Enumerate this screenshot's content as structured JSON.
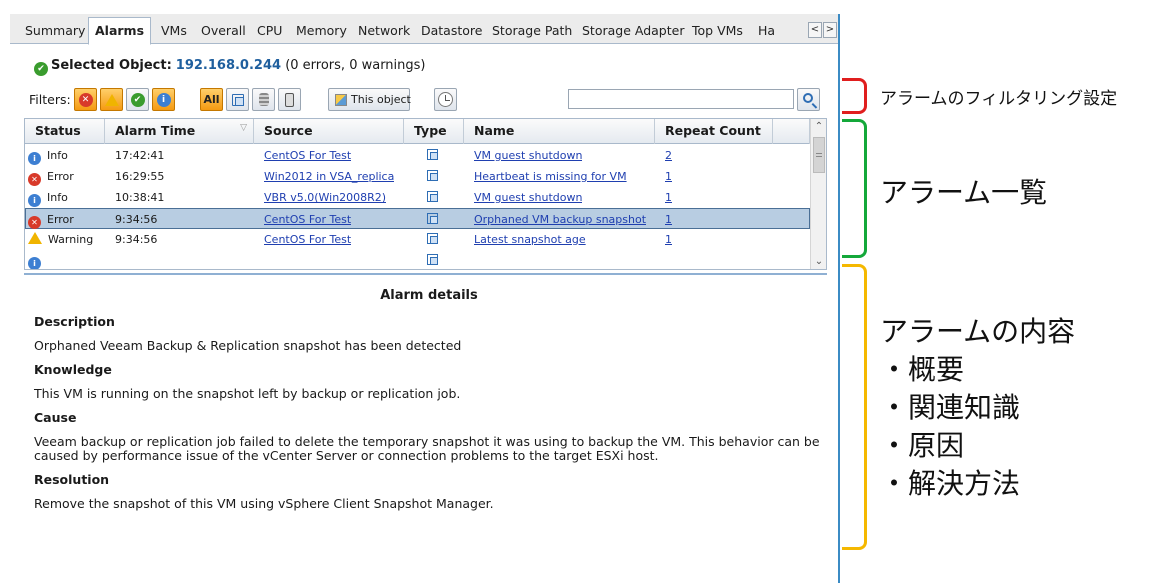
{
  "tabs": [
    {
      "label": "Summary",
      "active": false
    },
    {
      "label": "Alarms",
      "active": true
    },
    {
      "label": "VMs",
      "active": false
    },
    {
      "label": "Overall",
      "active": false
    },
    {
      "label": "CPU",
      "active": false
    },
    {
      "label": "Memory",
      "active": false
    },
    {
      "label": "Network",
      "active": false
    },
    {
      "label": "Datastore",
      "active": false
    },
    {
      "label": "Storage Path",
      "active": false
    },
    {
      "label": "Storage Adapter",
      "active": false
    },
    {
      "label": "Top VMs",
      "active": false
    },
    {
      "label": "Ha",
      "active": false
    }
  ],
  "tab_nav": {
    "prev": "<",
    "next": ">"
  },
  "selected_object": {
    "label": "Selected Object:",
    "value": "192.168.0.244",
    "summary": "(0 errors, 0 warnings)"
  },
  "filters": {
    "label": "Filters:",
    "all_label": "All",
    "this_object_label": "This object",
    "search_value": "",
    "search_placeholder": ""
  },
  "grid": {
    "columns": [
      "Status",
      "Alarm Time",
      "Source",
      "Type",
      "Name",
      "Repeat Count"
    ],
    "rows": [
      {
        "status": "Info",
        "time": "17:42:41",
        "source": "CentOS For Test",
        "name": "VM guest shutdown",
        "count": "2",
        "selected": false
      },
      {
        "status": "Error",
        "time": "16:29:55",
        "source": "Win2012 in VSA_replica",
        "name": "Heartbeat is missing for VM",
        "count": "1",
        "selected": false
      },
      {
        "status": "Info",
        "time": "10:38:41",
        "source": "VBR v5.0(Win2008R2)",
        "name": "VM guest shutdown",
        "count": "1",
        "selected": false
      },
      {
        "status": "Error",
        "time": "9:34:56",
        "source": "CentOS For Test",
        "name": "Orphaned VM backup snapshot",
        "count": "1",
        "selected": true
      },
      {
        "status": "Warning",
        "time": "9:34:56",
        "source": "CentOS For Test",
        "name": "Latest snapshot age",
        "count": "1",
        "selected": false
      }
    ]
  },
  "details": {
    "title": "Alarm details",
    "description_heading": "Description",
    "description": "Orphaned Veeam Backup & Replication snapshot has been detected",
    "knowledge_heading": "Knowledge",
    "knowledge": "This VM is running on the snapshot left by backup or replication job.",
    "cause_heading": "Cause",
    "cause": "Veeam backup or replication job failed to delete the temporary snapshot it was using to backup the VM. This behavior can be caused by performance issue of the vCenter Server or connection problems to the target ESXi host.",
    "resolution_heading": "Resolution",
    "resolution": "Remove the snapshot of this VM using vSphere Client Snapshot Manager."
  },
  "annotations": {
    "filter": "アラームのフィルタリング設定",
    "list": "アラーム一覧",
    "detail_title": "アラームの内容",
    "detail_items": [
      "・概要",
      "・関連知識",
      "・原因",
      "・解決方法"
    ]
  },
  "colors": {
    "accent": "#1f5f9e",
    "link": "#1f3fb0",
    "selected_row": "#b8cde2",
    "bracket_red": "#e01e1e",
    "bracket_green": "#14a83a",
    "bracket_yellow": "#f5b800"
  },
  "icons": {
    "error_filter": "error-icon",
    "warning_filter": "warning-icon",
    "ok_filter": "ok-icon",
    "info_filter": "info-icon",
    "vm_filter": "vm-icon",
    "datastore_filter": "datastore-icon",
    "host_filter": "host-icon",
    "time_filter": "clock-icon",
    "search": "search-icon"
  }
}
